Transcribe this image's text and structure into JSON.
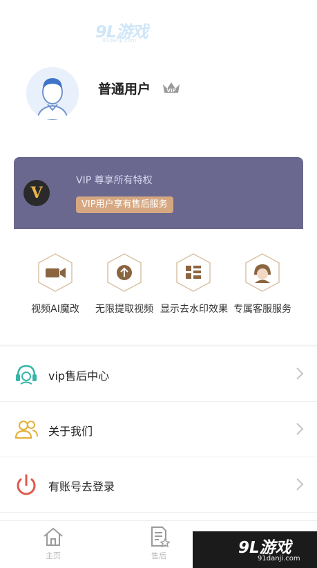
{
  "watermark": {
    "logo": "9L游戏",
    "url": "91danji.com"
  },
  "profile": {
    "username": "普通用户",
    "badge": "VIP"
  },
  "vip_card": {
    "logo": "V",
    "title": "VIP 尊享所有特权",
    "badge": "VIP用户享有售后服务"
  },
  "features": [
    {
      "label": "视频AI魔改"
    },
    {
      "label": "无限提取视频"
    },
    {
      "label": "显示去水印效果"
    },
    {
      "label": "专属客服服务"
    }
  ],
  "menu": [
    {
      "label": "vip售后中心"
    },
    {
      "label": "关于我们"
    },
    {
      "label": "有账号去登录"
    }
  ],
  "tabs": [
    {
      "label": "主页"
    },
    {
      "label": "售后"
    }
  ],
  "colors": {
    "vip_card_bg": "#6a688f",
    "accent_gold": "#d6a882",
    "hex_border": "#d9c3a7"
  }
}
